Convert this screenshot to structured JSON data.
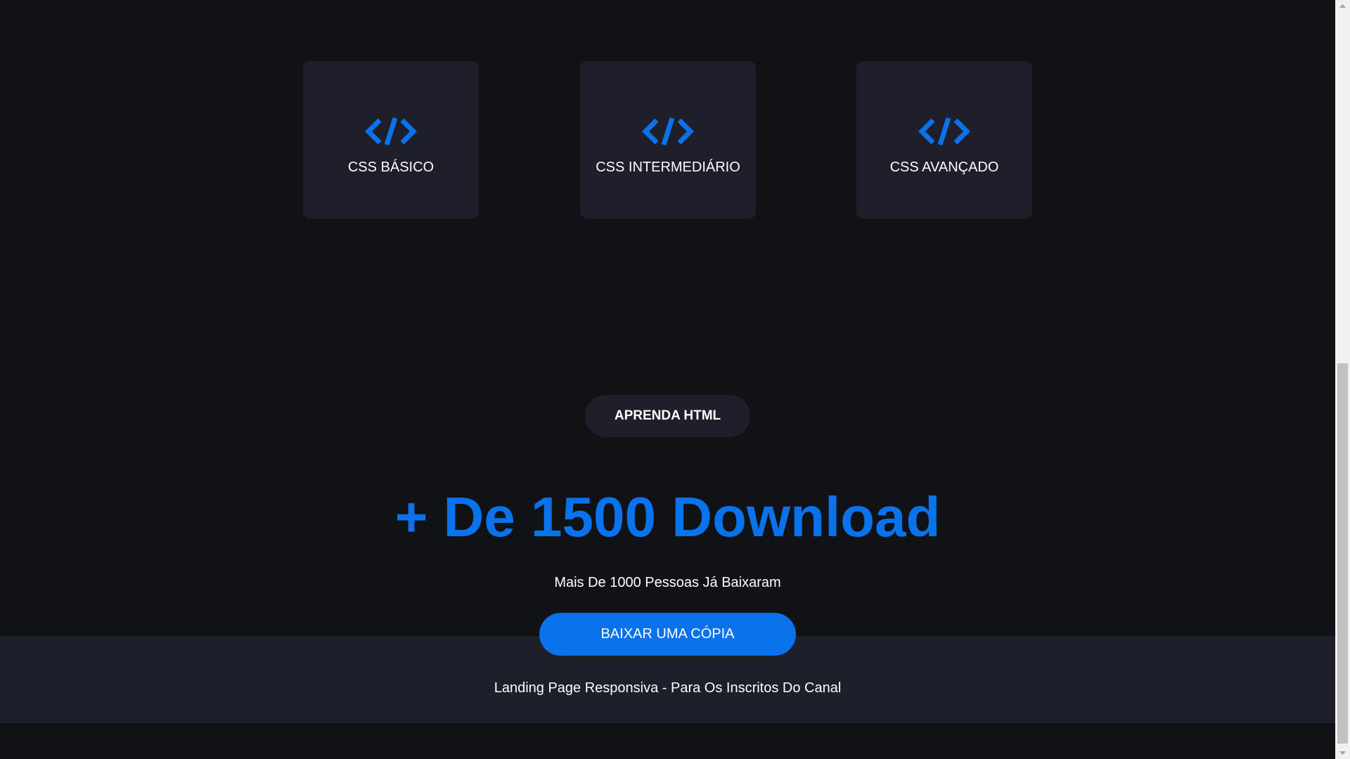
{
  "cards": [
    {
      "label": "CSS BÁSICO",
      "icon": "code-icon"
    },
    {
      "label": "CSS INTERMEDIÁRIO",
      "icon": "code-icon"
    },
    {
      "label": "CSS AVANÇADO",
      "icon": "code-icon"
    }
  ],
  "section": {
    "pill_label": "APRENDA HTML",
    "headline": "+ De 1500 Download",
    "subline": "Mais De 1000 Pessoas Já Baixaram",
    "cta_label": "BAIXAR UMA CÓPIA"
  },
  "footer": {
    "text": "Landing Page Responsiva - Para Os Inscritos Do Canal"
  },
  "colors": {
    "background": "#111216",
    "card": "#1e1f2b",
    "accent": "#0a73ec",
    "text": "#ffffff"
  }
}
